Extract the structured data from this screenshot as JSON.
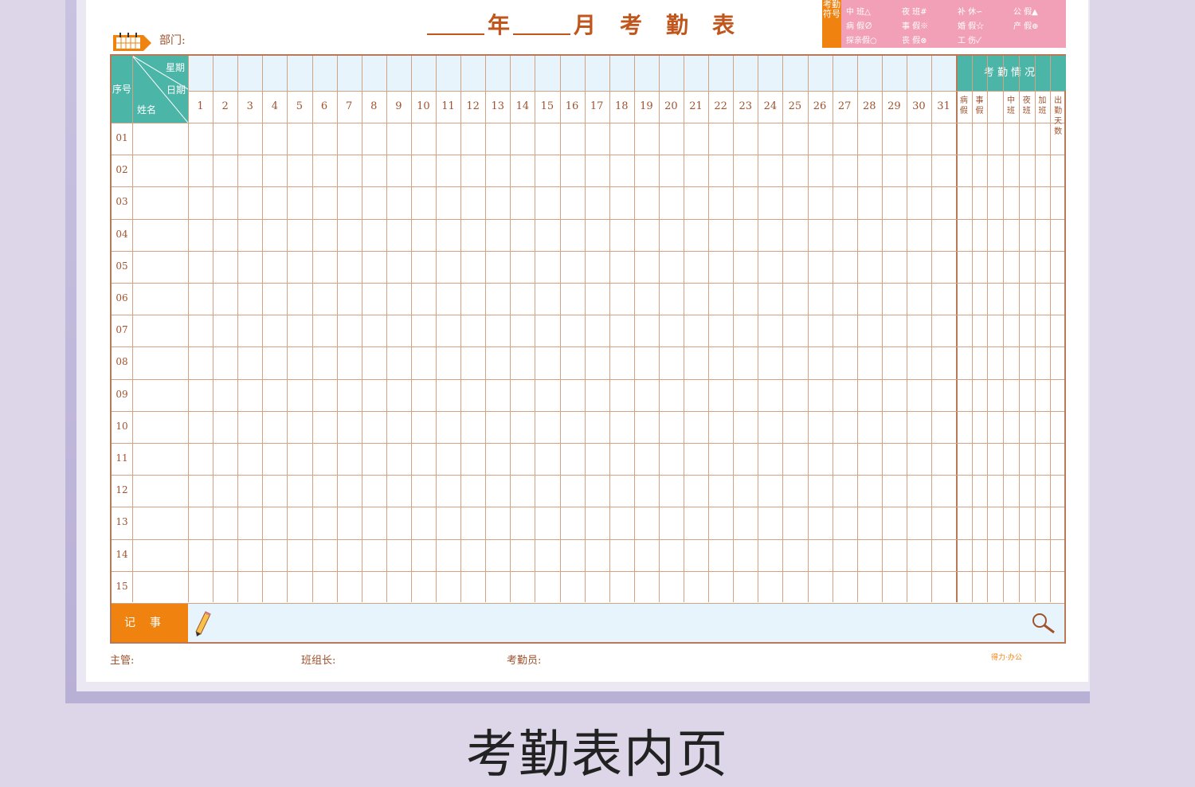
{
  "header": {
    "department_label": "部门:",
    "year_label": "年",
    "month_label": "月",
    "title": "考勤表"
  },
  "legend": {
    "tag": "考勤符号",
    "items": [
      "中 班△",
      "夜 班#",
      "补 休∽",
      "公 假▲",
      "病 假∅",
      "事 假※",
      "婚 假☆",
      "产 假⊕",
      "探亲假○",
      "丧 假⊗",
      "工 伤✓"
    ]
  },
  "table": {
    "seq_header": "序号",
    "week_header": "星期",
    "date_header": "日期",
    "name_header": "姓名",
    "days": [
      "1",
      "2",
      "3",
      "4",
      "5",
      "6",
      "7",
      "8",
      "9",
      "10",
      "11",
      "12",
      "13",
      "14",
      "15",
      "16",
      "17",
      "18",
      "19",
      "20",
      "21",
      "22",
      "23",
      "24",
      "25",
      "26",
      "27",
      "28",
      "29",
      "30",
      "31"
    ],
    "summary_header": "考勤情况",
    "summary_columns": [
      "病假",
      "事假",
      "",
      "中班",
      "夜班",
      "加班",
      "出勤天数"
    ],
    "rows": [
      "01",
      "02",
      "03",
      "04",
      "05",
      "06",
      "07",
      "08",
      "09",
      "10",
      "11",
      "12",
      "13",
      "14",
      "15"
    ]
  },
  "notes": {
    "label": "记事"
  },
  "footer": {
    "supervisor_label": "主管:",
    "team_leader_label": "班组长:",
    "clerk_label": "考勤员:",
    "brand": "得力·办公"
  },
  "caption": "考勤表内页",
  "colors": {
    "teal": "#4bb5a8",
    "orange": "#f0820f",
    "pink": "#f2a0b8",
    "line": "#d2a283",
    "light_blue": "#e7f4fb"
  }
}
